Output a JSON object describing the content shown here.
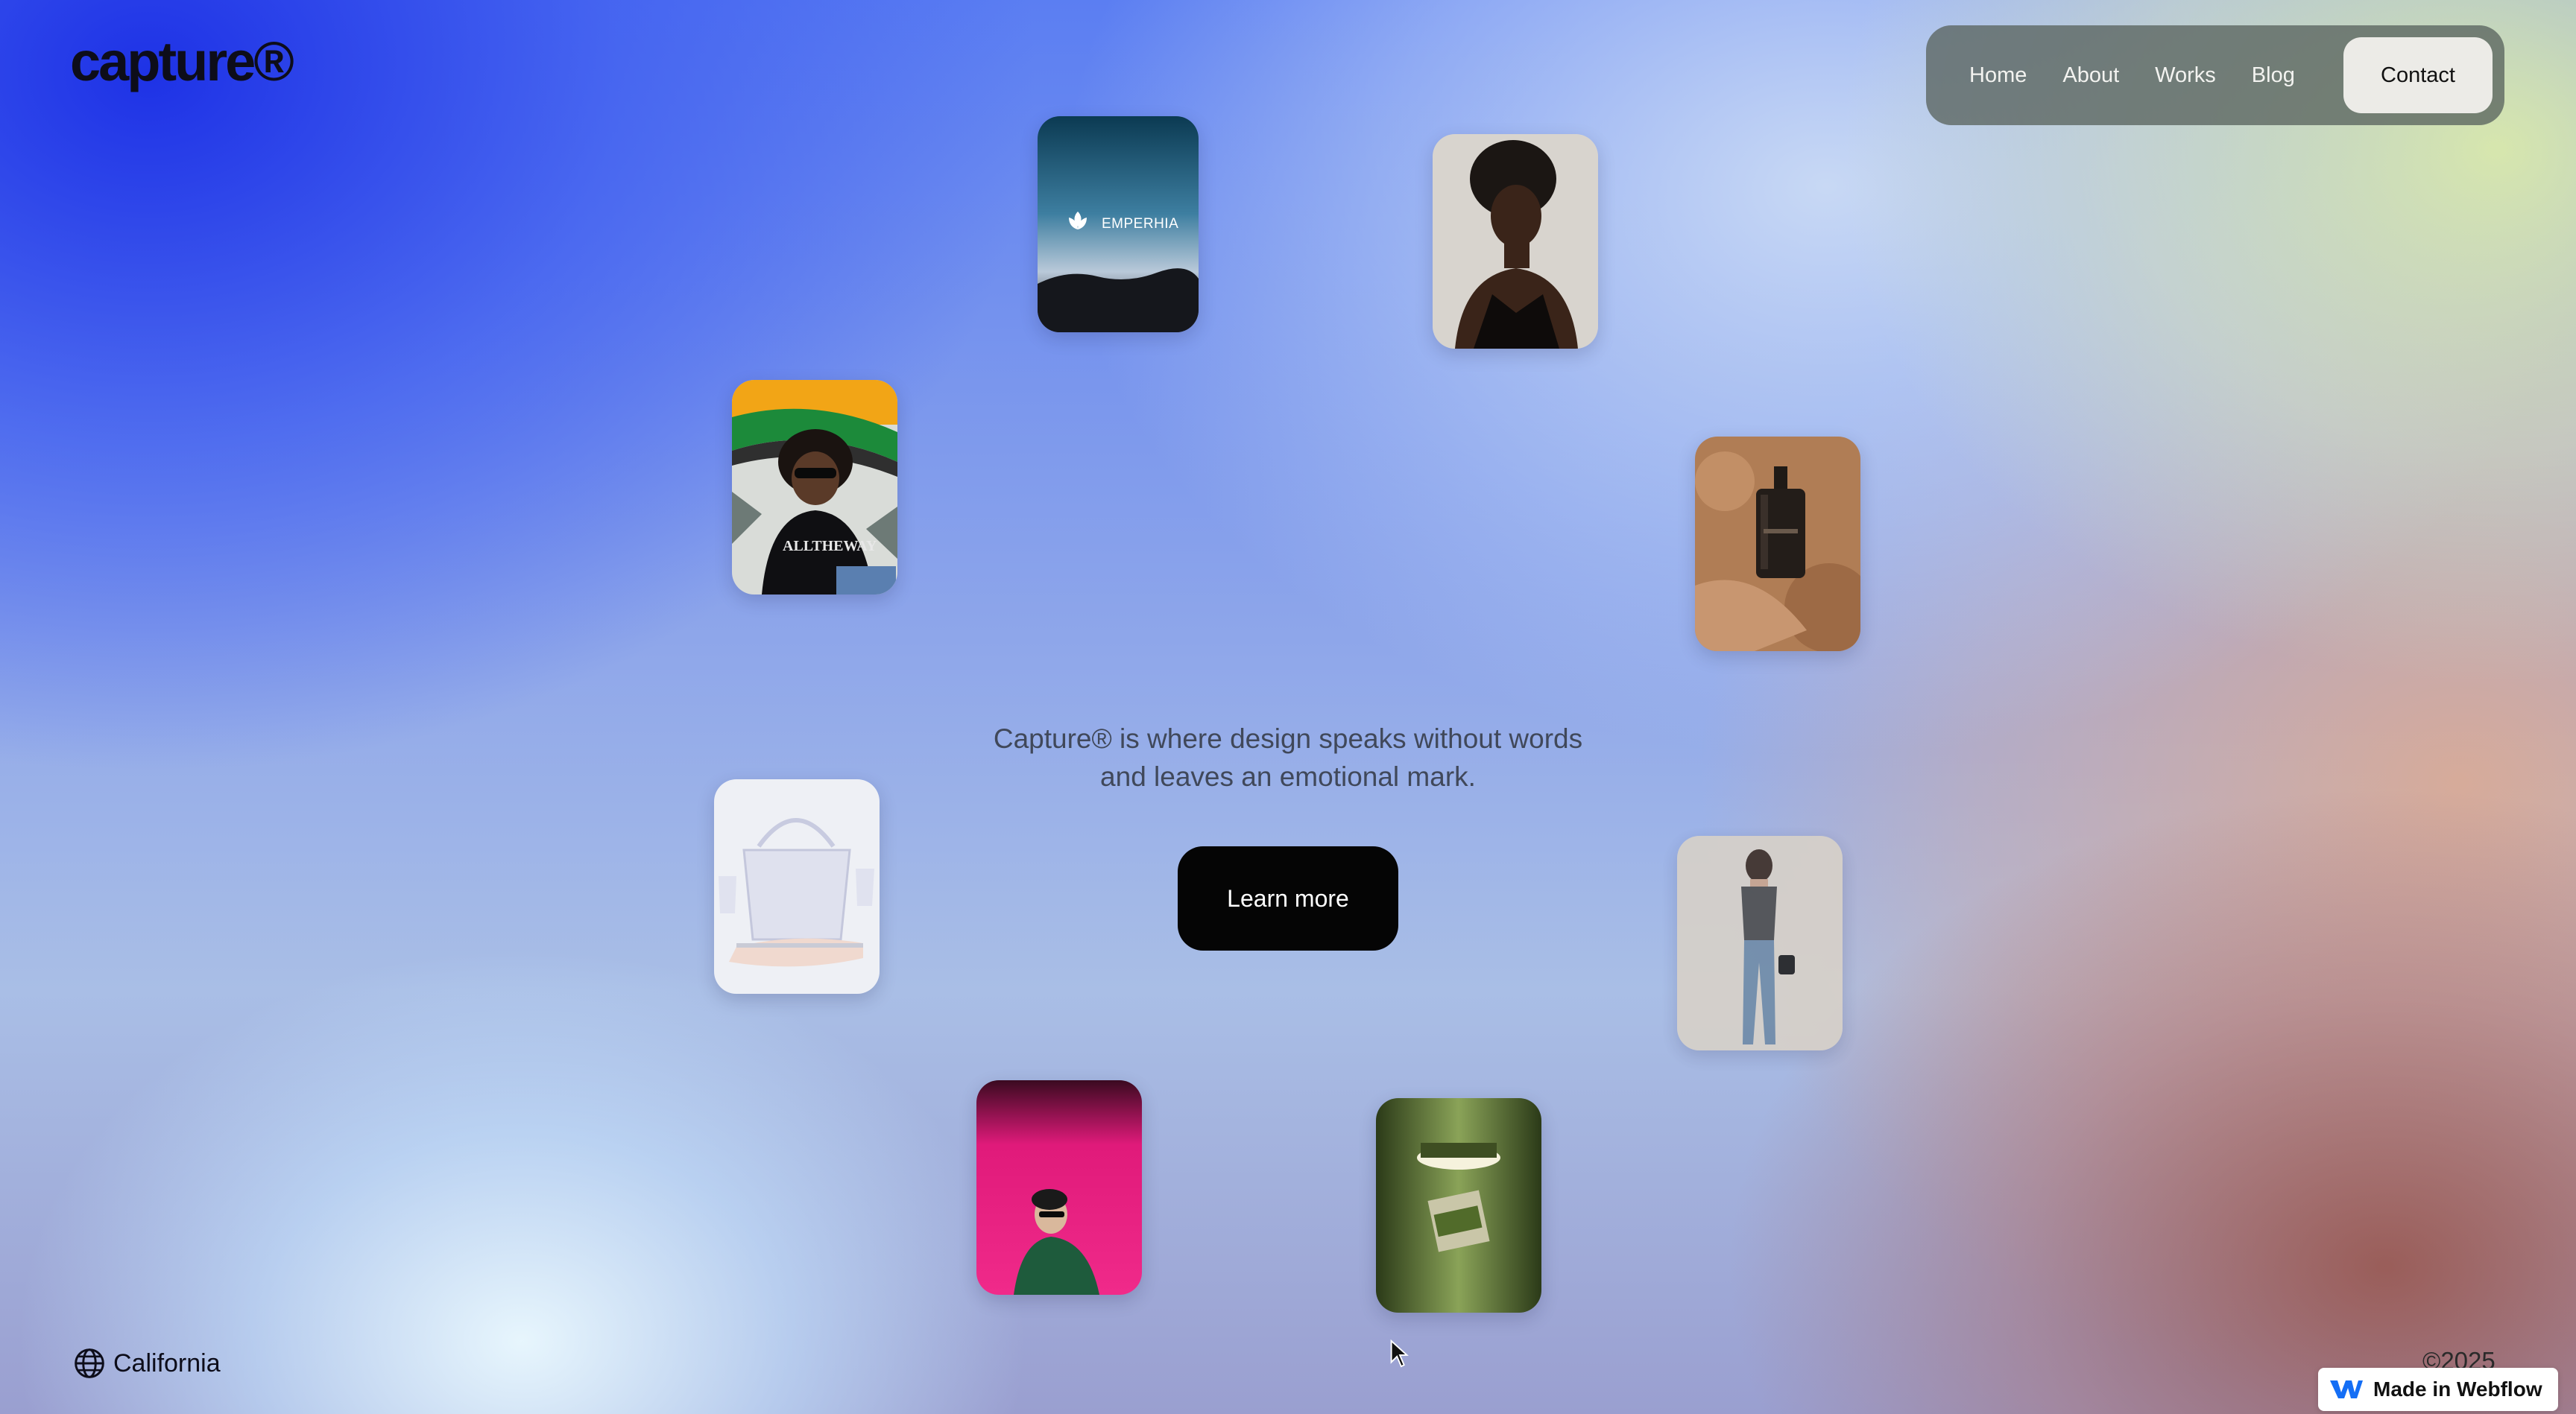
{
  "brand": {
    "logo": "capture®"
  },
  "nav": {
    "items": [
      {
        "label": "Home"
      },
      {
        "label": "About"
      },
      {
        "label": "Works"
      },
      {
        "label": "Blog"
      }
    ],
    "contact_label": "Contact"
  },
  "gallery": {
    "cards": [
      {
        "subject": "emperhia-brand-card",
        "text": "EMPERHIA"
      },
      {
        "subject": "woman-portrait"
      },
      {
        "subject": "child-sunglasses",
        "text": "ALLTHEWAY"
      },
      {
        "subject": "perfume-bottle-sand"
      },
      {
        "subject": "glass-handbag"
      },
      {
        "subject": "woman-denim"
      },
      {
        "subject": "man-pink-wall"
      },
      {
        "subject": "green-product-lamp"
      }
    ]
  },
  "hero": {
    "tagline_line1": "Capture® is where design speaks without words",
    "tagline_line2": "and leaves an emotional mark.",
    "cta_label": "Learn more"
  },
  "footer": {
    "location": "California",
    "location_icon": "globe-icon",
    "copyright": "©2025",
    "badge_label": "Made in Webflow",
    "badge_icon": "webflow-logo-icon"
  },
  "colors": {
    "accent_dark": "#050505",
    "nav_bg": "#5a645f",
    "contact_bg": "#ecebe7",
    "webflow_blue": "#146ef5"
  }
}
